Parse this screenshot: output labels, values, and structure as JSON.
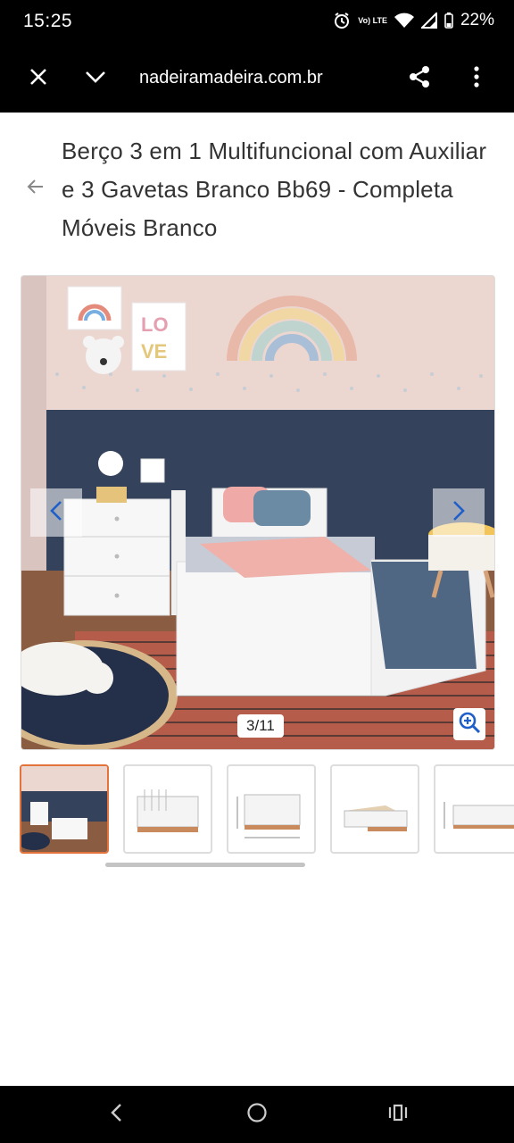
{
  "status": {
    "time": "15:25",
    "network_label": "Vo) LTE",
    "battery": "22%"
  },
  "browser": {
    "url": "nadeiramadeira.com.br",
    "close_icon": "close-icon",
    "menu_icon": "chevron-down-icon",
    "share_icon": "share-icon",
    "more_icon": "more-vertical-icon"
  },
  "product": {
    "title": "Berço 3 em 1 Multifuncional com Auxiliar e 3 Gavetas Branco Bb69 - Completa Móveis Branco"
  },
  "gallery": {
    "counter": "3/11",
    "prev_icon": "chevron-left-icon",
    "next_icon": "chevron-right-icon",
    "zoom_icon": "zoom-in-icon",
    "thumbnails": [
      {
        "active": true
      },
      {
        "active": false
      },
      {
        "active": false
      },
      {
        "active": false
      },
      {
        "active": false
      }
    ]
  },
  "colors": {
    "accent": "#e2733b",
    "nav_blue": "#1f5fc9"
  }
}
